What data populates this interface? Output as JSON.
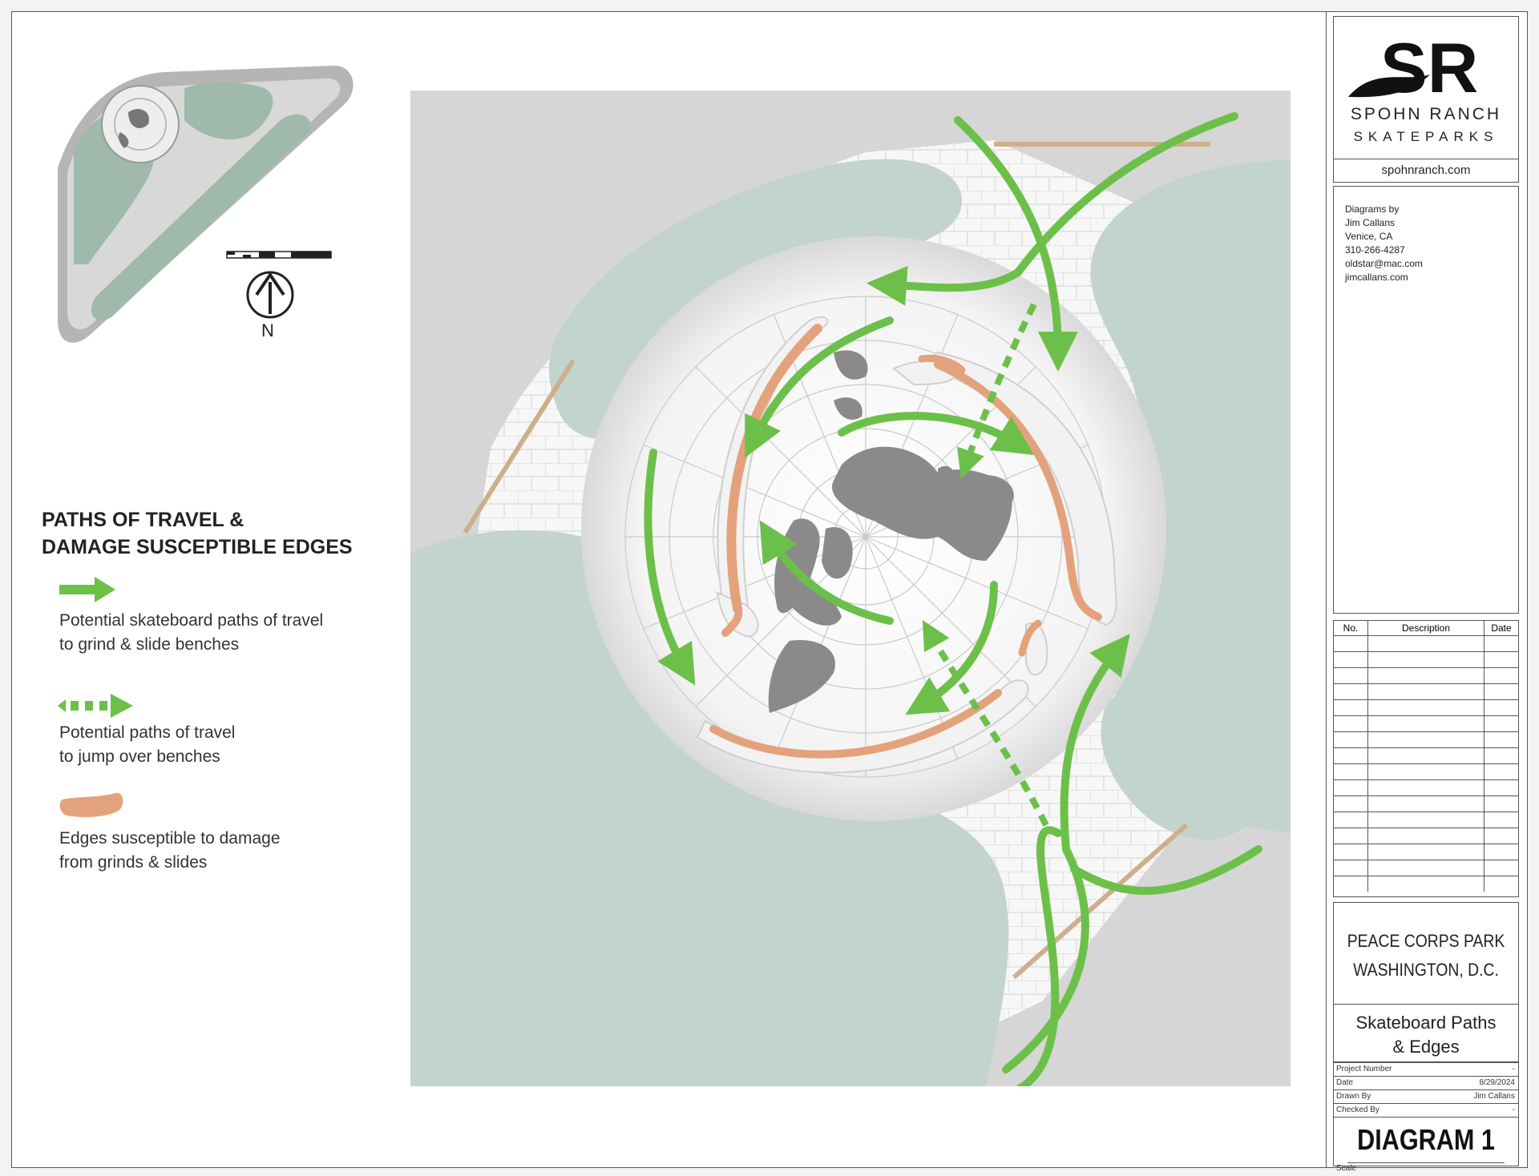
{
  "legend": {
    "title_line1": "PATHS OF TRAVEL &",
    "title_line2": "DAMAGE SUSCEPTIBLE EDGES",
    "items": [
      {
        "icon": "solid-arrow-icon",
        "line1": "Potential skateboard paths of travel",
        "line2": "to grind & slide benches"
      },
      {
        "icon": "dashed-arrow-icon",
        "line1": "Potential paths of travel",
        "line2": "to jump over benches"
      },
      {
        "icon": "edge-swatch-icon",
        "line1": "Edges susceptible to damage",
        "line2": "from grinds & slides"
      }
    ]
  },
  "north_label": "N",
  "title_block": {
    "logo_letters": "SR",
    "company_line1": "SPOHN RANCH",
    "company_line2": "SKATEPARKS",
    "website": "spohnranch.com",
    "credits": [
      "Diagrams by",
      "Jim Callans",
      "Venice, CA",
      "310-266-4287",
      "oldstar@mac.com",
      "jimcallans.com"
    ],
    "revision_headers": [
      "No.",
      "Description",
      "Date"
    ],
    "project_line1": "PEACE CORPS PARK",
    "project_line2": "WASHINGTON, D.C.",
    "sheet_title_line1": "Skateboard Paths",
    "sheet_title_line2": "& Edges",
    "meta": [
      {
        "label": "Project Number",
        "value": "-"
      },
      {
        "label": "Date",
        "value": "8/29/2024"
      },
      {
        "label": "Drawn By",
        "value": "Jim Callans"
      },
      {
        "label": "Checked By",
        "value": "-"
      }
    ],
    "diagram_label": "DIAGRAM 1",
    "scale_label": "Scale"
  },
  "colors": {
    "path_green": "#6cc04a",
    "lawn": "#c2d4cb",
    "walkway": "#d6d6d6",
    "edge_orange": "#e3a27c",
    "continent": "#8a8a8a"
  }
}
